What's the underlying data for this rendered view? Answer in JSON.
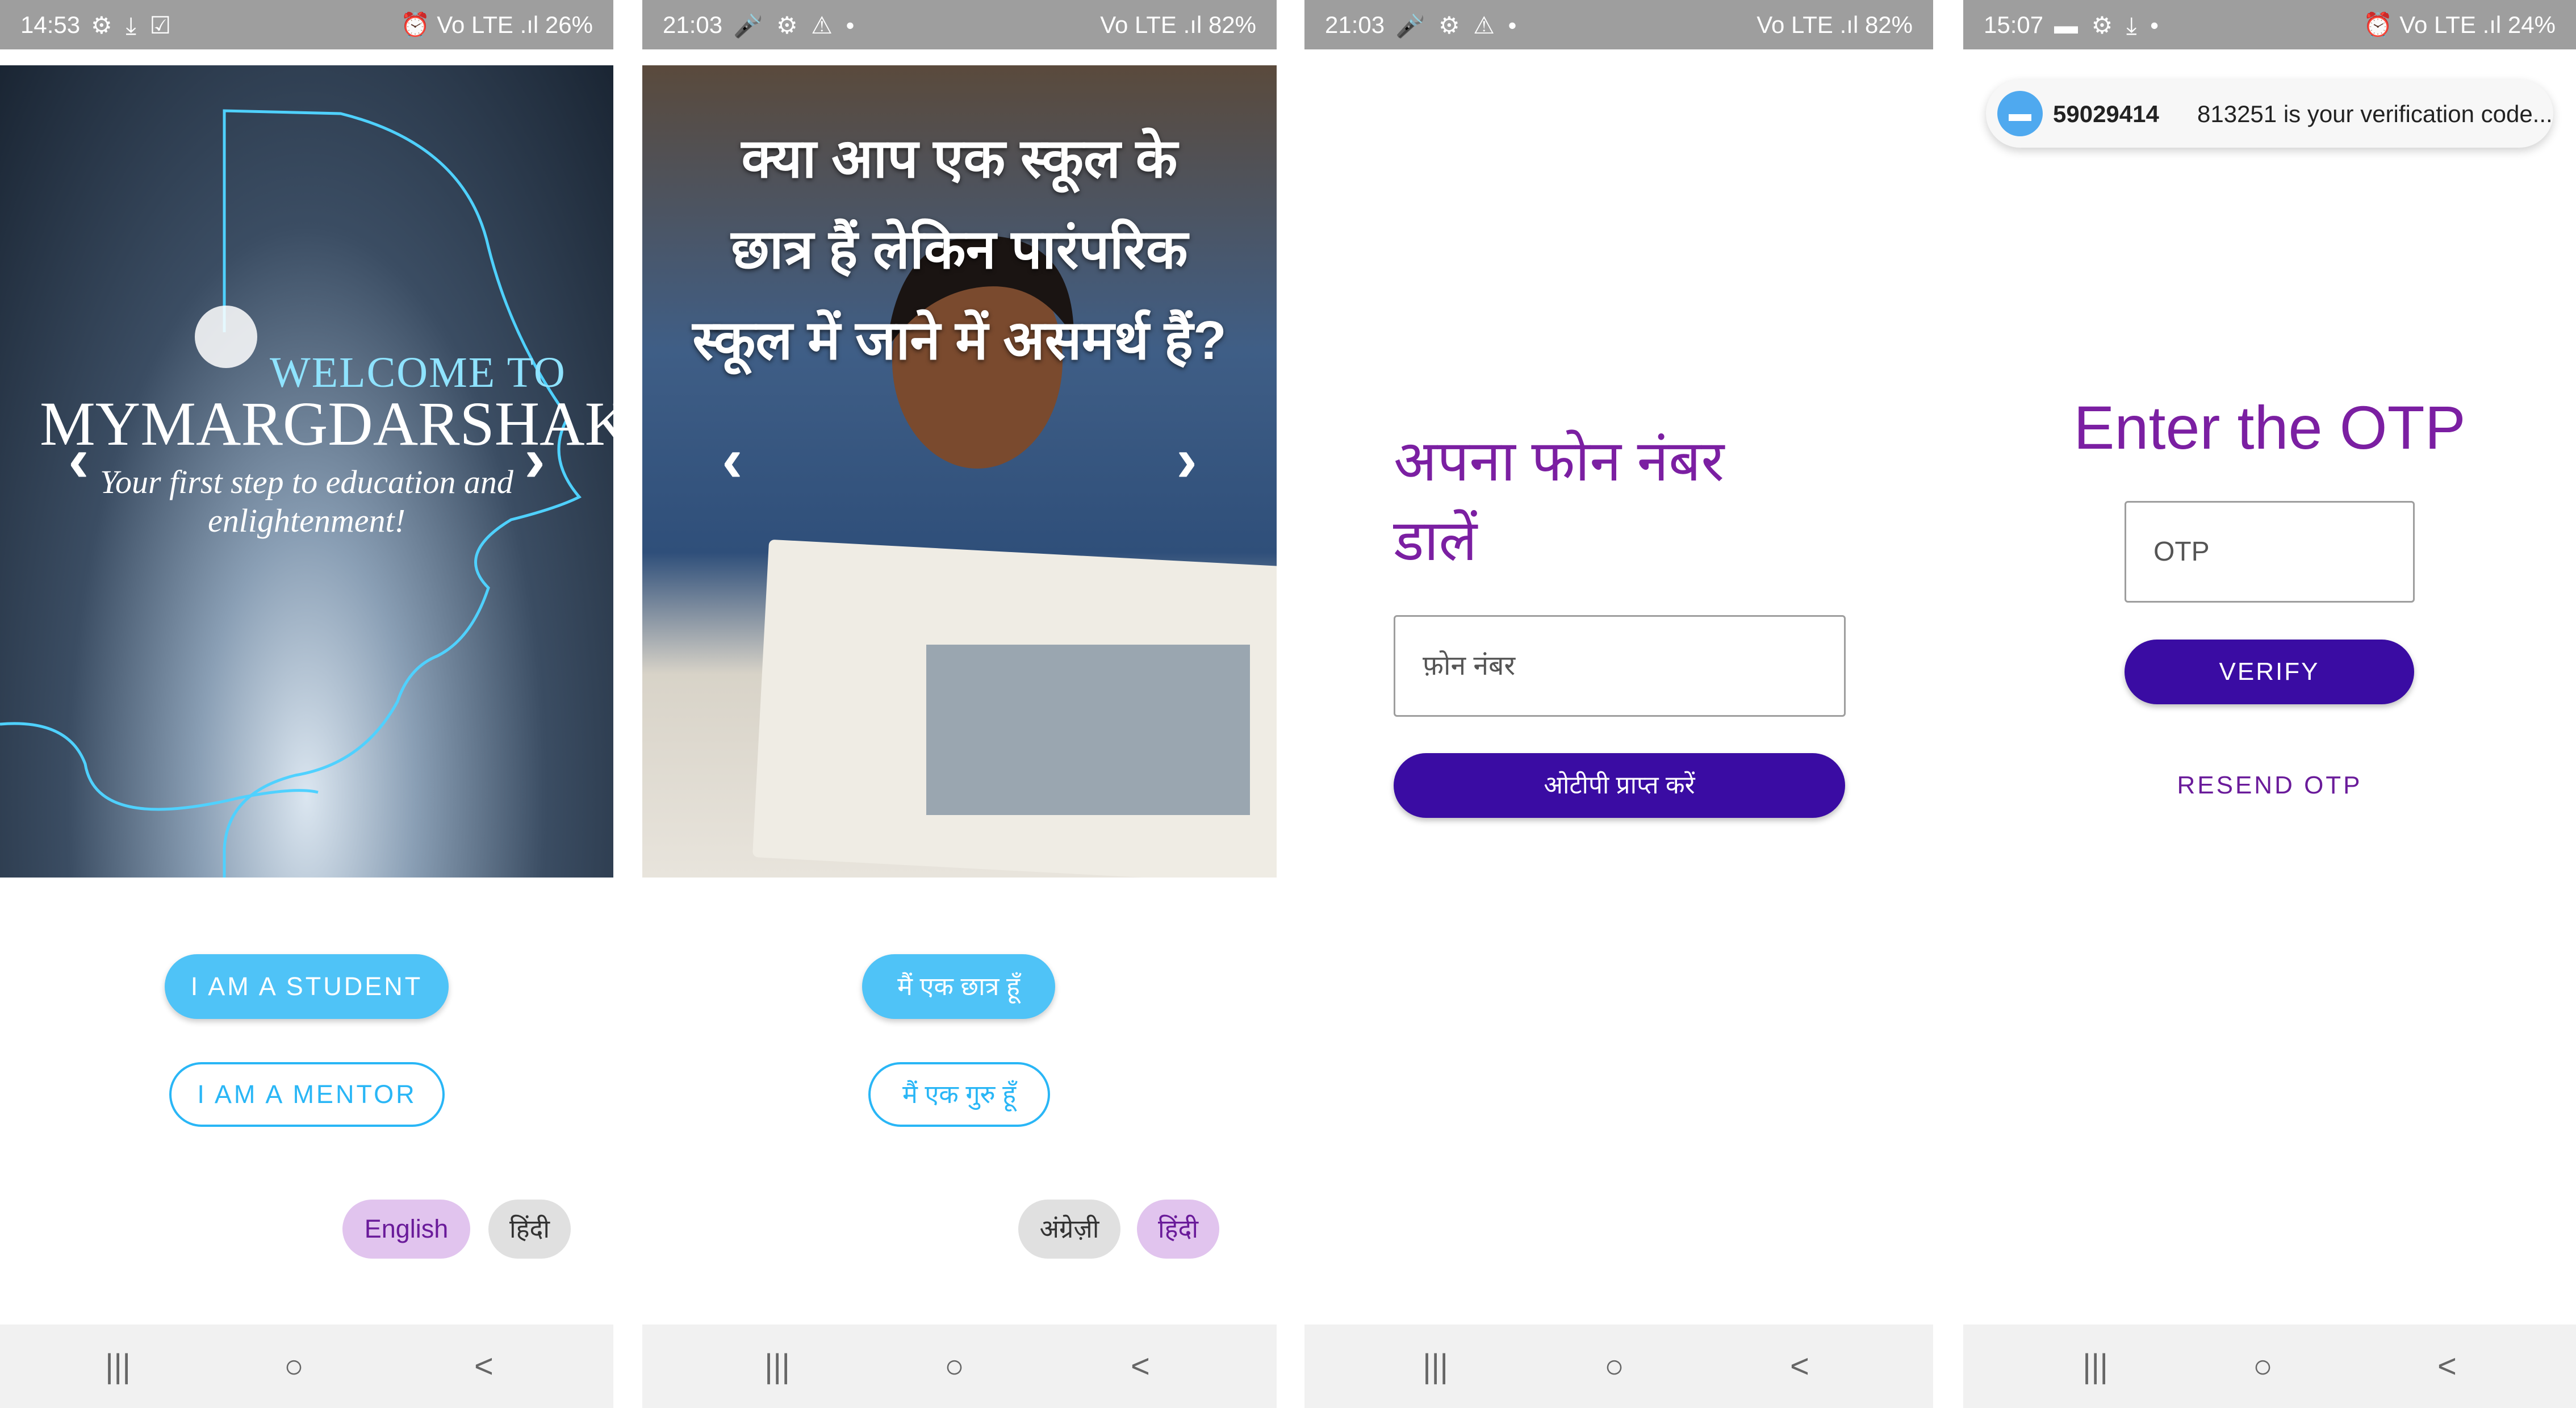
{
  "screens": [
    {
      "status": {
        "time": "14:53",
        "icons": "⚙ ⤓ ☑",
        "right": "⏰ Vo LTE .ıl 26%"
      },
      "carousel": {
        "welcome": "WELCOME TO",
        "app_name": "MYMARGDARSHAKA!",
        "tagline_1": "Your first step to education and",
        "tagline_2": "enlightenment!"
      },
      "student_label": "I AM A STUDENT",
      "mentor_label": "I AM A MENTOR",
      "lang": {
        "english": "English",
        "hindi": "हिंदी",
        "selected": "english"
      }
    },
    {
      "status": {
        "time": "21:03",
        "icons": "🎤 ⚙ ⚠ •",
        "right": "Vo LTE .ıl 82%"
      },
      "carousel": {
        "line1": "क्या आप एक स्कूल के",
        "line2": "छात्र हैं लेकिन पारंपरिक",
        "line3": "स्कूल में जाने में असमर्थ हैं?"
      },
      "student_label": "मैं एक छात्र हूँ",
      "mentor_label": "मैं एक गुरु हूँ",
      "lang": {
        "english": "अंग्रेज़ी",
        "hindi": "हिंदी",
        "selected": "hindi"
      }
    },
    {
      "status": {
        "time": "21:03",
        "icons": "🎤 ⚙ ⚠ •",
        "right": "Vo LTE .ıl 82%"
      },
      "title_line1": "अपना फोन नंबर",
      "title_line2": "डालें",
      "phone_placeholder": "फ़ोन नंबर",
      "get_otp": "ओटीपी प्राप्त करें"
    },
    {
      "status": {
        "time": "15:07",
        "icons": "▬ ⚙ ⤓ •",
        "right": "⏰ Vo LTE .ıl 24%"
      },
      "notification": {
        "sender": "59029414",
        "message": "813251 is your verification code..."
      },
      "title": "Enter the OTP",
      "otp_placeholder": "OTP",
      "verify": "VERIFY",
      "resend": "RESEND OTP"
    }
  ],
  "nav": {
    "recents": "|||",
    "home": "○",
    "back": "<"
  },
  "colors": {
    "accent_purple": "#7b1fa2",
    "button_purple": "#3a0ca3",
    "student_blue": "#4fc3f7",
    "chip_selected": "#e1c4ee"
  }
}
